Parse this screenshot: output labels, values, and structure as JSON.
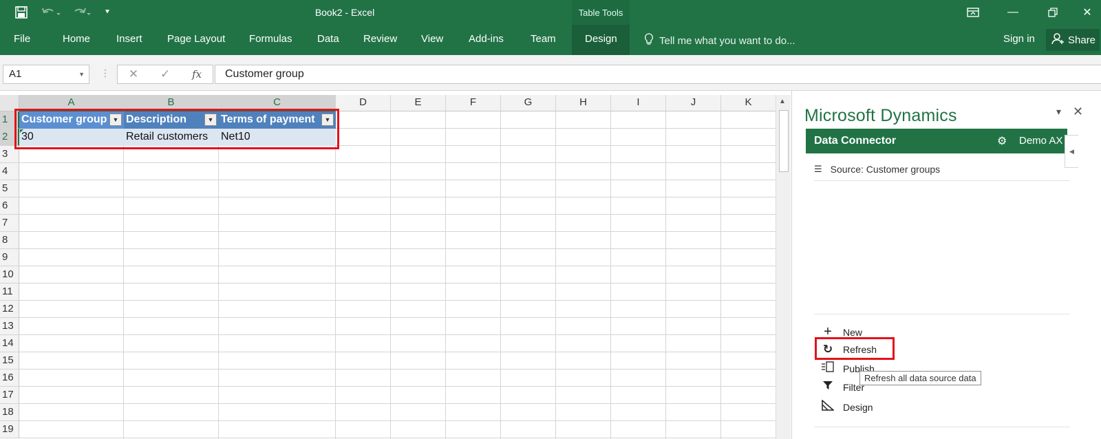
{
  "titlebar": {
    "doc_title": "Book2 - Excel",
    "table_tools": "Table Tools"
  },
  "ribbon": {
    "tabs": [
      "File",
      "Home",
      "Insert",
      "Page Layout",
      "Formulas",
      "Data",
      "Review",
      "View",
      "Add-ins",
      "Team",
      "Design"
    ],
    "tell_me": "Tell me what you want to do...",
    "sign_in": "Sign in",
    "share": "Share"
  },
  "formula_bar": {
    "name_box": "A1",
    "content": "Customer group"
  },
  "sheet": {
    "columns": [
      "A",
      "B",
      "C",
      "D",
      "E",
      "F",
      "G",
      "H",
      "I",
      "J",
      "K"
    ],
    "rows": [
      "1",
      "2",
      "3",
      "4",
      "5",
      "6",
      "7",
      "8",
      "9",
      "10",
      "11",
      "12",
      "13",
      "14",
      "15",
      "16",
      "17",
      "18",
      "19"
    ],
    "table": {
      "headers": [
        "Customer group",
        "Description",
        "Terms of payment"
      ],
      "row": [
        "30",
        "Retail customers",
        "Net10"
      ]
    }
  },
  "pane": {
    "title": "Microsoft Dynamics",
    "connector": "Data Connector",
    "environment": "Demo AX",
    "source": "Source: Customer groups",
    "actions": [
      "New",
      "Refresh",
      "Publish",
      "Filter",
      "Design"
    ],
    "tooltip": "Refresh all data source data"
  },
  "colors": {
    "excel_green": "#217346",
    "table_header": "#4f81bd",
    "table_row": "#dce6f1",
    "highlight": "#e3121b"
  }
}
